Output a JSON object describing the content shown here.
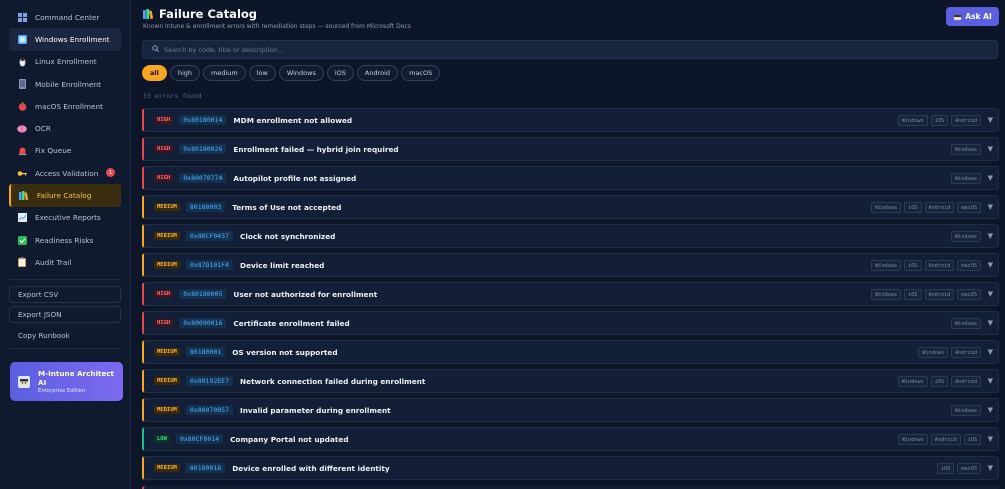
{
  "sidebar": {
    "items": [
      {
        "label": "Command Center",
        "icon": "grid-icon"
      },
      {
        "label": "Windows Enrollment",
        "icon": "windows-icon"
      },
      {
        "label": "Linux Enrollment",
        "icon": "penguin-icon"
      },
      {
        "label": "Mobile Enrollment",
        "icon": "phone-icon"
      },
      {
        "label": "macOS Enrollment",
        "icon": "apple-icon"
      },
      {
        "label": "OCR",
        "icon": "brain-icon"
      },
      {
        "label": "Fix Queue",
        "icon": "siren-icon"
      },
      {
        "label": "Access Validation",
        "icon": "key-icon",
        "badge": "1"
      },
      {
        "label": "Failure Catalog",
        "icon": "books-icon"
      },
      {
        "label": "Executive Reports",
        "icon": "chart-icon"
      },
      {
        "label": "Readiness Risks",
        "icon": "check-icon"
      },
      {
        "label": "Audit Trail",
        "icon": "clipboard-icon"
      }
    ],
    "buttons": {
      "export_csv": "Export CSV",
      "export_json": "Export JSON",
      "copy_runbook": "Copy Runbook"
    },
    "brand": {
      "name": "M-Intune Architect AI",
      "edition": "Enterprise Edition"
    }
  },
  "header": {
    "title": "Failure Catalog",
    "subtitle": "Known Intune & enrollment errors with remediation steps — sourced from Microsoft Docs",
    "ask_label": "Ask AI"
  },
  "search": {
    "placeholder": "Search by code, title or description..."
  },
  "filters": [
    "all",
    "high",
    "medium",
    "low",
    "Windows",
    "iOS",
    "Android",
    "macOS"
  ],
  "count_text": "33 errors found",
  "colors": {
    "accent": "#f5a623",
    "high": "#e5484d",
    "medium": "#f5a623",
    "low": "#1fbf8f",
    "brand": "#5b5fe0"
  },
  "errors": [
    {
      "severity": "HIGH",
      "code": "0x80180014",
      "title": "MDM enrollment not allowed",
      "platforms": [
        "Windows",
        "iOS",
        "Android"
      ]
    },
    {
      "severity": "HIGH",
      "code": "0x80180026",
      "title": "Enrollment failed — hybrid join required",
      "platforms": [
        "Windows"
      ]
    },
    {
      "severity": "HIGH",
      "code": "0x80070774",
      "title": "Autopilot profile not assigned",
      "platforms": [
        "Windows"
      ]
    },
    {
      "severity": "MEDIUM",
      "code": "80180003",
      "title": "Terms of Use not accepted",
      "platforms": [
        "Windows",
        "iOS",
        "Android",
        "macOS"
      ]
    },
    {
      "severity": "MEDIUM",
      "code": "0x80CF0437",
      "title": "Clock not synchronized",
      "platforms": [
        "Windows"
      ]
    },
    {
      "severity": "MEDIUM",
      "code": "0x87D101F4",
      "title": "Device limit reached",
      "platforms": [
        "Windows",
        "iOS",
        "Android",
        "macOS"
      ]
    },
    {
      "severity": "HIGH",
      "code": "0x80180005",
      "title": "User not authorized for enrollment",
      "platforms": [
        "Windows",
        "iOS",
        "Android",
        "macOS"
      ]
    },
    {
      "severity": "HIGH",
      "code": "0x80090016",
      "title": "Certificate enrollment failed",
      "platforms": [
        "Windows"
      ]
    },
    {
      "severity": "MEDIUM",
      "code": "80180001",
      "title": "OS version not supported",
      "platforms": [
        "Windows",
        "Android"
      ]
    },
    {
      "severity": "MEDIUM",
      "code": "0x80192EE7",
      "title": "Network connection failed during enrollment",
      "platforms": [
        "Windows",
        "iOS",
        "Android"
      ]
    },
    {
      "severity": "MEDIUM",
      "code": "0x80070057",
      "title": "Invalid parameter during enrollment",
      "platforms": [
        "Windows"
      ]
    },
    {
      "severity": "LOW",
      "code": "0x80CF0014",
      "title": "Company Portal not updated",
      "platforms": [
        "Windows",
        "Android",
        "iOS"
      ]
    },
    {
      "severity": "MEDIUM",
      "code": "80180018",
      "title": "Device enrolled with different identity",
      "platforms": [
        "iOS",
        "macOS"
      ]
    }
  ]
}
